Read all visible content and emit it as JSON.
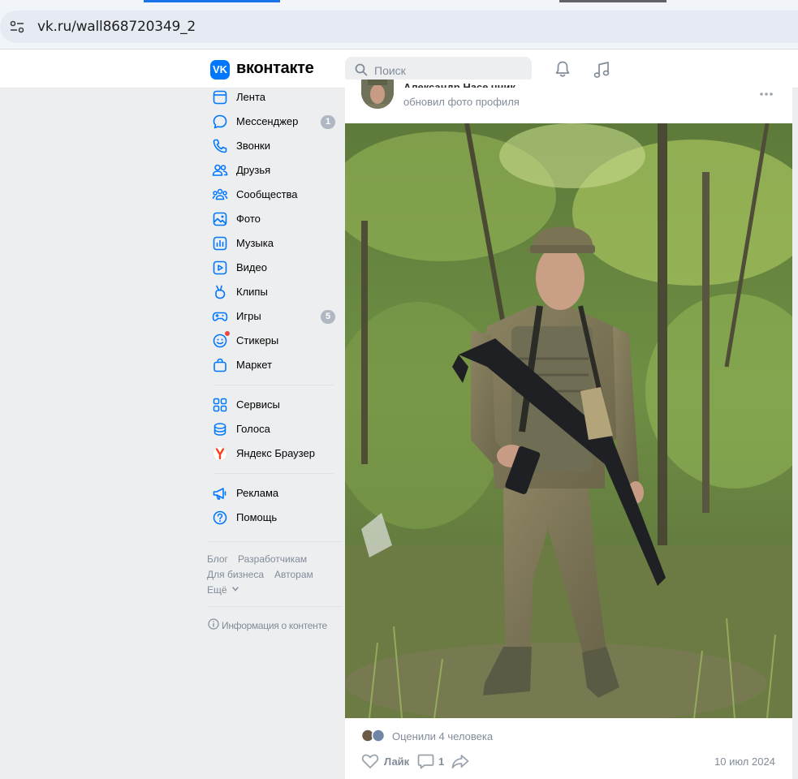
{
  "browser": {
    "url": "vk.ru/wall868720349_2"
  },
  "header": {
    "logo_letters": "VK",
    "logo_text": "вконтакте",
    "search_placeholder": "Поиск",
    "icons": [
      "bell-icon",
      "music-icon"
    ],
    "accent": "#0077ff"
  },
  "menu": {
    "items": [
      {
        "label": "Лента",
        "icon": "news-icon"
      },
      {
        "label": "Мессенджер",
        "icon": "messenger-icon",
        "badge": "1"
      },
      {
        "label": "Звонки",
        "icon": "phone-icon"
      },
      {
        "label": "Друзья",
        "icon": "friends-icon"
      },
      {
        "label": "Сообщества",
        "icon": "communities-icon"
      },
      {
        "label": "Фото",
        "icon": "photo-icon"
      },
      {
        "label": "Музыка",
        "icon": "music-icon"
      },
      {
        "label": "Видео",
        "icon": "video-icon"
      },
      {
        "label": "Клипы",
        "icon": "clips-icon"
      },
      {
        "label": "Игры",
        "icon": "games-icon",
        "badge": "5"
      },
      {
        "label": "Стикеры",
        "icon": "stickers-icon"
      },
      {
        "label": "Маркет",
        "icon": "market-icon"
      }
    ],
    "items2": [
      {
        "label": "Сервисы",
        "icon": "services-icon"
      },
      {
        "label": "Голоса",
        "icon": "votes-icon"
      },
      {
        "label": "Яндекс Браузер",
        "icon": "yandex-browser-icon"
      }
    ],
    "items3": [
      {
        "label": "Реклама",
        "icon": "ads-icon"
      },
      {
        "label": "Помощь",
        "icon": "help-icon"
      }
    ],
    "footer": {
      "blog": "Блог",
      "developers": "Разработчикам",
      "business": "Для бизнеса",
      "authors": "Авторам",
      "more": "Ещё",
      "content_info": "Информация о контенте"
    }
  },
  "post": {
    "author": "Александр Насе чник",
    "action": "обновил фото профиля",
    "likers_text": "Оценили 4 человека",
    "like_label": "Лайк",
    "comment_count": "1",
    "date": "10 июл 2024"
  }
}
